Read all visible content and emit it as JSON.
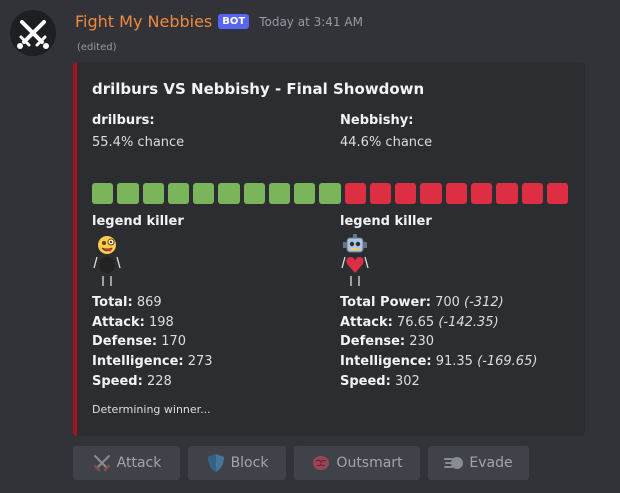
{
  "message": {
    "username": "Fight My Nebbies",
    "bot_tag": "BOT",
    "timestamp": "Today at 3:41 AM",
    "edited": "(edited)"
  },
  "embed": {
    "title": "drilburs VS Nebbishy - Final Showdown",
    "left": {
      "name": "drilburs:",
      "chance": "55.4% chance",
      "legend": "legend killer",
      "stats": [
        {
          "label": "Total:",
          "value": "869",
          "delta": ""
        },
        {
          "label": "Attack:",
          "value": "198",
          "delta": ""
        },
        {
          "label": "Defense:",
          "value": "170",
          "delta": ""
        },
        {
          "label": "Intelligence:",
          "value": "273",
          "delta": ""
        },
        {
          "label": "Speed:",
          "value": "228",
          "delta": ""
        }
      ]
    },
    "right": {
      "name": "Nebbishy:",
      "chance": "44.6% chance",
      "legend": "legend killer",
      "stats": [
        {
          "label": "Total Power:",
          "value": "700",
          "delta": "(-312)"
        },
        {
          "label": "Attack:",
          "value": "76.65",
          "delta": "(-142.35)"
        },
        {
          "label": "Defense:",
          "value": "230",
          "delta": ""
        },
        {
          "label": "Intelligence:",
          "value": "91.35",
          "delta": "(-169.65)"
        },
        {
          "label": "Speed:",
          "value": "302",
          "delta": ""
        }
      ]
    },
    "chance_bar": {
      "green_segments": 10,
      "red_segments": 9,
      "green_color": "#7ab55c",
      "red_color": "#dd2e44"
    },
    "footer": "Determining winner..."
  },
  "buttons": [
    {
      "label": "Attack",
      "icon": "crossed-swords-icon"
    },
    {
      "label": "Block",
      "icon": "shield-icon"
    },
    {
      "label": "Outsmart",
      "icon": "brain-icon"
    },
    {
      "label": "Evade",
      "icon": "dash-icon"
    }
  ]
}
